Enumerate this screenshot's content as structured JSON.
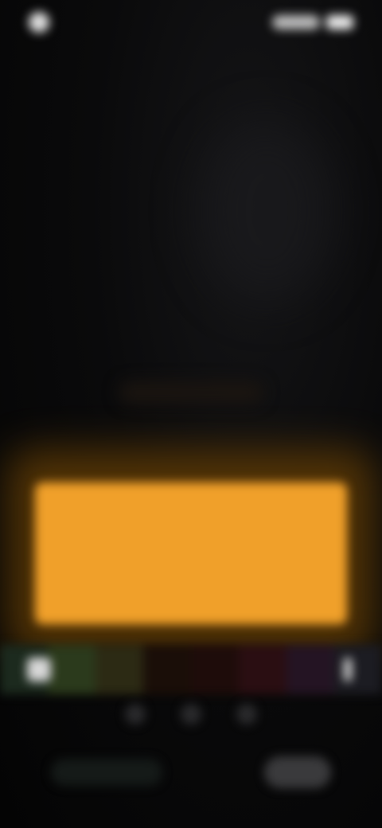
{
  "status_bar": {
    "time": "",
    "indicators": [
      "signal-icon",
      "battery-icon"
    ]
  },
  "text_card": {
    "background_color": "#f0a02a",
    "lines": [
      "",
      "",
      "",
      ""
    ]
  },
  "filter_strip": {
    "swatches": [
      "#1c2a1e",
      "#2b3a1c",
      "#2c2a14",
      "#1a0e08",
      "#1e0c0a",
      "#2a0e12",
      "#241423",
      "#1c1c22"
    ]
  },
  "bottom_bar": {
    "left_label": "",
    "right_label": ""
  }
}
